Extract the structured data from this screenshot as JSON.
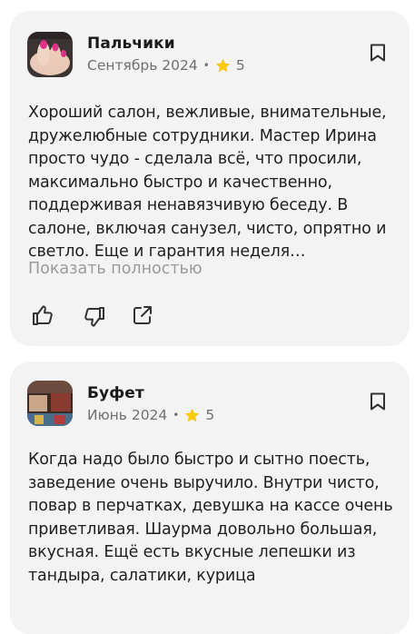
{
  "reviews": [
    {
      "author": "Пальчики",
      "date": "Сентябрь 2024",
      "separator": "•",
      "rating": "5",
      "text": "Хороший салон, вежливые, внимательные, дружелюбные сотрудники. Мастер Ирина просто чудо - сделала всё, что просили, максимально быстро и качественно, поддерживая ненавязчивую беседу. В салоне, включая санузел, чисто, опрятно и светло. Еще и гарантия неделя…",
      "show_more": "Показать полностью"
    },
    {
      "author": "Буфет",
      "date": "Июнь 2024",
      "separator": "•",
      "rating": "5",
      "text": "Когда надо было быстро и сытно поесть, заведение очень выручило. Внутри чисто, повар в перчатках, девушка на кассе очень приветливая. Шаурма довольно большая, вкусная. Ещё есть вкусные лепешки из тандыра, салатики, курица"
    }
  ],
  "colors": {
    "card_bg": "#f3f3f4",
    "star": "#ffcc00",
    "muted": "#707070",
    "link_muted": "#9a9a9a"
  },
  "icons": [
    "bookmark-icon",
    "star-icon",
    "thumbs-up-icon",
    "thumbs-down-icon",
    "share-icon"
  ]
}
